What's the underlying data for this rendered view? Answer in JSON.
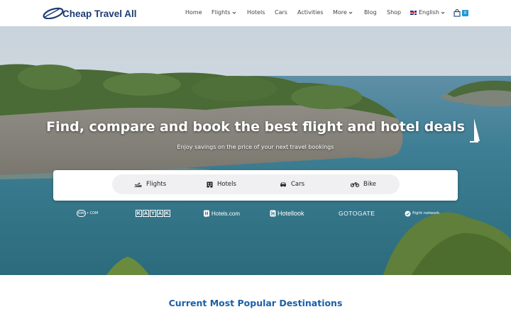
{
  "brand": {
    "name": "Cheap Travel All"
  },
  "nav": {
    "items": [
      {
        "label": "Home",
        "dropdown": false
      },
      {
        "label": "Flights",
        "dropdown": true
      },
      {
        "label": "Hotels",
        "dropdown": false
      },
      {
        "label": "Cars",
        "dropdown": false
      },
      {
        "label": "Activities",
        "dropdown": false
      },
      {
        "label": "More",
        "dropdown": true
      },
      {
        "label": "Blog",
        "dropdown": false
      },
      {
        "label": "Shop",
        "dropdown": false
      }
    ],
    "language": {
      "label": "English",
      "flag_icon": "uk-flag-icon"
    },
    "cart": {
      "icon": "shopping-bag-icon",
      "count": "0",
      "badge_color": "#1a9bd7"
    }
  },
  "hero": {
    "title": "Find, compare and book the best flight and hotel deals",
    "subtitle": "Enjoy savings on the price of your next travel bookings"
  },
  "search": {
    "tabs": [
      {
        "label": "Flights",
        "icon": "airplane-icon"
      },
      {
        "label": "Hotels",
        "icon": "hotel-building-icon"
      },
      {
        "label": "Cars",
        "icon": "car-icon"
      },
      {
        "label": "Bike",
        "icon": "motorbike-icon"
      }
    ]
  },
  "partners": {
    "kiwi": {
      "circle": "KIWI",
      "suffix": "• COM"
    },
    "kayak": [
      "K",
      "A",
      "Y",
      "A",
      "K"
    ],
    "hotels": "Hotels.com",
    "hotellook": "Hotellook",
    "gotogate": "GOTOGATE",
    "flightnetwork": "flight network"
  },
  "section": {
    "heading": "Current Most Popular Destinations"
  },
  "colors": {
    "brand": "#1f3b73",
    "heading": "#1b5fa8",
    "badge": "#1a9bd7"
  }
}
